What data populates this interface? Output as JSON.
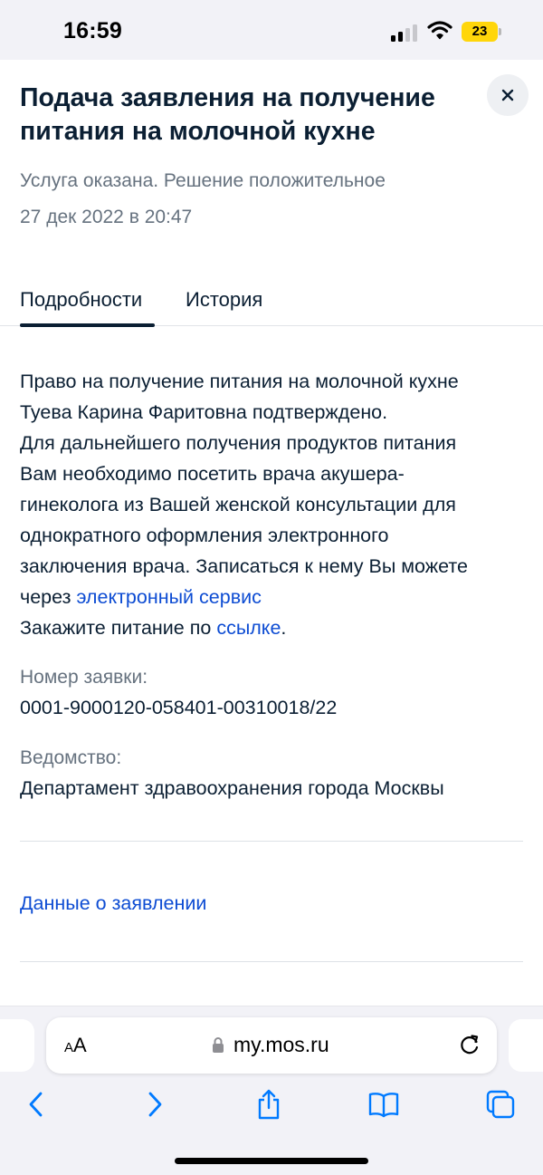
{
  "status_bar": {
    "time": "16:59",
    "battery": "23"
  },
  "header": {
    "title": "Подача заявления на получение питания на молочной кухне",
    "status": "Услуга оказана. Решение положительное",
    "date": "27 дек 2022 в 20:47"
  },
  "tabs": [
    {
      "label": "Подробности",
      "active": true
    },
    {
      "label": "История",
      "active": false
    }
  ],
  "details": {
    "line_1": "Право на получение питания на молочной кухне",
    "line_2": "Туева Карина Фаритовна подтверждено.",
    "line_3": "Для дальнейшего получения продуктов питания",
    "line_4": "Вам необходимо посетить врача акушера-",
    "line_5": "гинеколога из Вашей женской консультации для",
    "line_6": "однократного оформления электронного",
    "line_7": "заключения врача. Записаться к нему Вы можете",
    "line_8_prefix": "через ",
    "line_8_link": "электронный сервис",
    "line_9_prefix": "Закажите питание по ",
    "line_9_link": "ссылке",
    "line_9_suffix": "."
  },
  "fields": {
    "application_number_label": "Номер заявки:",
    "application_number_value": "0001-9000120-058401-00310018/22",
    "department_label": "Ведомство:",
    "department_value": "Департамент здравоохранения города Москвы"
  },
  "application_data_link": "Данные о заявлении",
  "browser": {
    "text_size_small": "A",
    "text_size_big": "A",
    "url": "my.mos.ru"
  },
  "colors": {
    "text": "#0b1f33",
    "muted": "#66727f",
    "link": "#0d4cd3",
    "ios_blue": "#007aff",
    "battery": "#ffd60a"
  }
}
